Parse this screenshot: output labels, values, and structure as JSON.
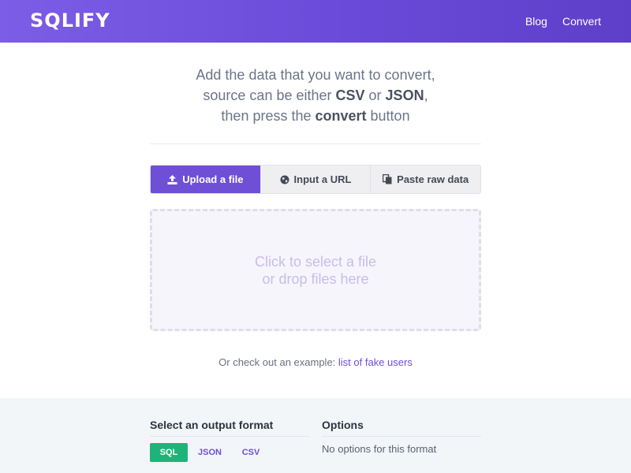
{
  "header": {
    "logo": "SQLIFY",
    "nav": [
      {
        "label": "Blog"
      },
      {
        "label": "Convert"
      }
    ],
    "background": "#6a4bd9"
  },
  "intro": {
    "line1": "Add the data that you want to convert,",
    "line2_prefix": "source can be either ",
    "line2_csv": "CSV",
    "line2_or": " or ",
    "line2_json": "JSON",
    "line2_suffix": ",",
    "line3_prefix": "then press the ",
    "line3_convert": "convert",
    "line3_suffix": " button"
  },
  "tabs": [
    {
      "label": "Upload a file",
      "icon": "upload-icon",
      "active": true
    },
    {
      "label": "Input a URL",
      "icon": "globe-icon",
      "active": false
    },
    {
      "label": "Paste raw data",
      "icon": "clipboard-icon",
      "active": false
    }
  ],
  "dropzone": {
    "line1": "Click to select a file",
    "line2": "or drop files here"
  },
  "example": {
    "prefix": "Or check out an example: ",
    "link": "list of fake users"
  },
  "output": {
    "title": "Select an output format",
    "formats": [
      {
        "label": "SQL",
        "active": true
      },
      {
        "label": "JSON",
        "active": false
      },
      {
        "label": "CSV",
        "active": false
      }
    ]
  },
  "options": {
    "title": "Options",
    "empty_text": "No options for this format"
  },
  "colors": {
    "accent": "#6e4fd6",
    "active_format": "#1fb37a",
    "footer_bg": "#f3f6f9"
  }
}
